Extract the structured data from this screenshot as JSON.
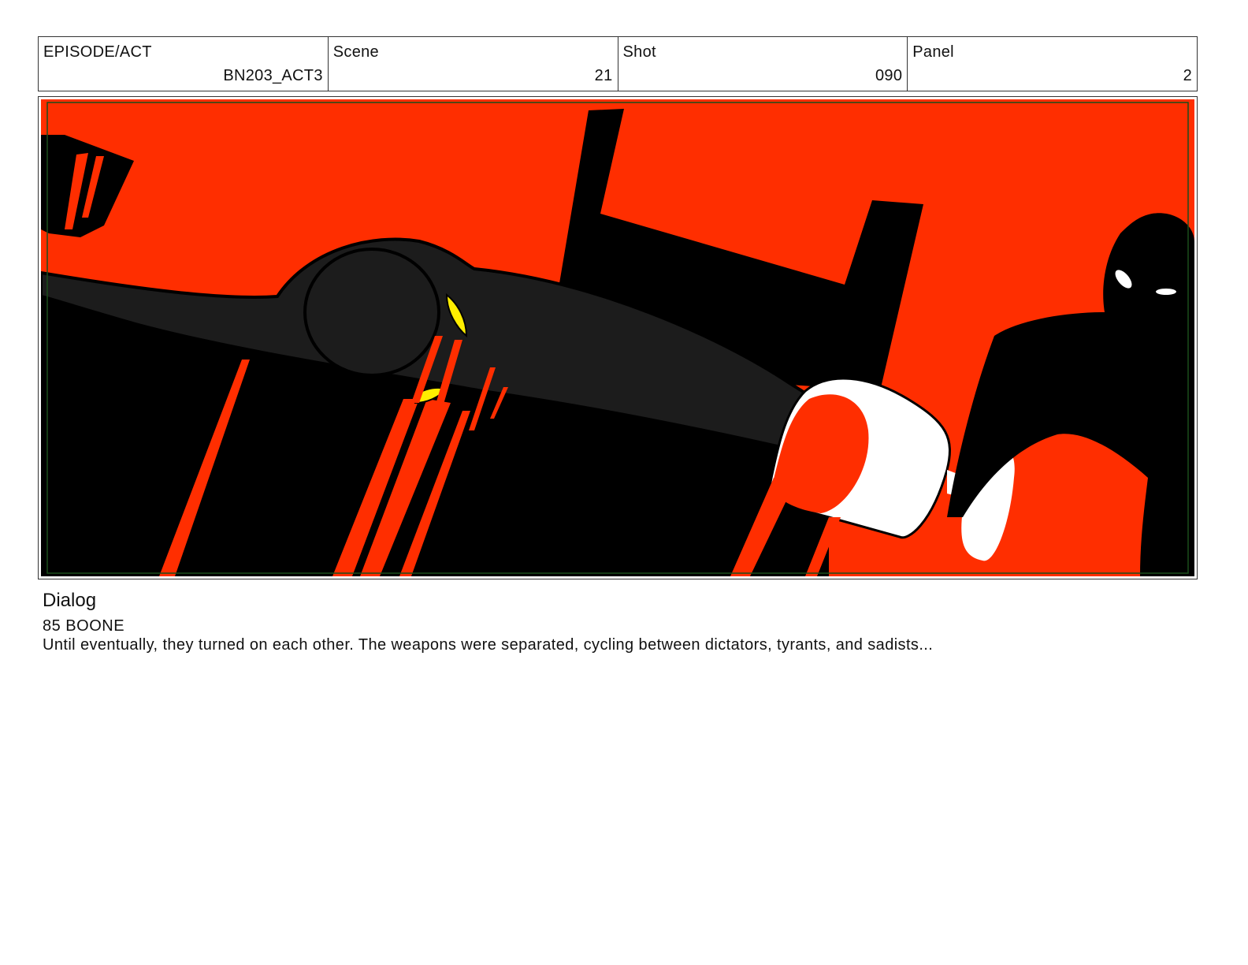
{
  "header": {
    "episode_label": "EPISODE/ACT",
    "episode_value": "BN203_ACT3",
    "scene_label": "Scene",
    "scene_value": "21",
    "shot_label": "Shot",
    "shot_value": "090",
    "panel_label": "Panel",
    "panel_value": "2"
  },
  "colors": {
    "background_red": "#ff2e00",
    "black": "#000000",
    "dark_gray": "#1c1c1c",
    "yellow": "#ffee00",
    "white": "#ffffff"
  },
  "dialog": {
    "title": "Dialog",
    "speaker": "85 BOONE",
    "line": "Until eventually, they turned on each other. The weapons were separated, cycling between dictators, tyrants, and sadists..."
  }
}
